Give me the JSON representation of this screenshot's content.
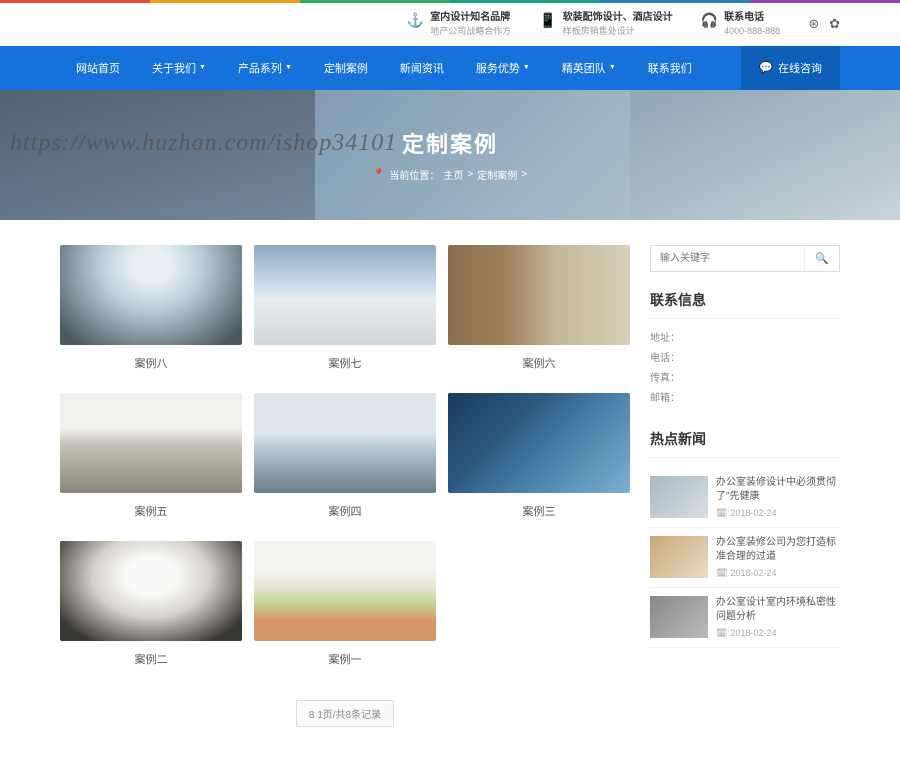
{
  "rainbow": [
    "#e74c3c",
    "#f39c12",
    "#27ae60",
    "#16a085",
    "#2980b9",
    "#8e44ad"
  ],
  "top": {
    "b1": {
      "t1": "室内设计知名品牌",
      "t2": "地产公司战略合作方"
    },
    "b2": {
      "t1": "软装配饰设计、酒店设计",
      "t2": "样板房销售处设计"
    },
    "b3": {
      "t1": "联系电话",
      "t2": "4000-888-888"
    }
  },
  "nav": {
    "items": [
      {
        "label": "网站首页",
        "drop": false
      },
      {
        "label": "关于我们",
        "drop": true
      },
      {
        "label": "产品系列",
        "drop": true
      },
      {
        "label": "定制案例",
        "drop": false
      },
      {
        "label": "新闻资讯",
        "drop": false
      },
      {
        "label": "服务优势",
        "drop": true
      },
      {
        "label": "精英团队",
        "drop": true
      },
      {
        "label": "联系我们",
        "drop": false
      }
    ],
    "chat": "在线咨询"
  },
  "hero": {
    "title": "定制案例",
    "crumb_prefix": "当前位置：",
    "crumb_home": "主页",
    "crumb_sep": ">",
    "crumb_cur": "定制案例",
    "crumb_sep2": ">"
  },
  "watermark": "https://www.huzhan.com/ishop34101",
  "cases": {
    "items": [
      {
        "title": "案例八"
      },
      {
        "title": "案例七"
      },
      {
        "title": "案例六"
      },
      {
        "title": "案例五"
      },
      {
        "title": "案例四"
      },
      {
        "title": "案例三"
      },
      {
        "title": "案例二"
      },
      {
        "title": "案例一"
      }
    ]
  },
  "pager": {
    "text": "8 1页/共8条记录"
  },
  "sidebar": {
    "search_placeholder": "输入关键字",
    "contact_title": "联系信息",
    "contact": {
      "addr_label": "地址：",
      "tel_label": "电话：",
      "fax_label": "传真：",
      "mail_label": "邮箱："
    },
    "news_title": "热点新闻",
    "news": [
      {
        "title": "办公室装修设计中必须贯彻了\"先健康",
        "date": "2018-02-24"
      },
      {
        "title": "办公室装修公司为您打造标准合理的过道",
        "date": "2018-02-24"
      },
      {
        "title": "办公室设计室内环境私密性问题分析",
        "date": "2018-02-24"
      }
    ]
  }
}
